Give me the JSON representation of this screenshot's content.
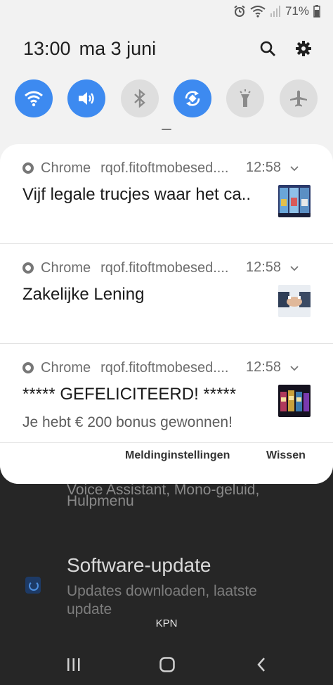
{
  "status_bar": {
    "battery": "71%",
    "icons": [
      "alarm-icon",
      "wifi-icon",
      "signal-icon",
      "battery-icon"
    ]
  },
  "header": {
    "time": "13:00",
    "date": "ma 3 juni",
    "icons": [
      "search-icon",
      "gear-icon"
    ]
  },
  "quick_toggles": [
    {
      "name": "wifi",
      "state": "on"
    },
    {
      "name": "sound",
      "state": "on"
    },
    {
      "name": "bluetooth",
      "state": "off"
    },
    {
      "name": "auto-rotate",
      "state": "on"
    },
    {
      "name": "flashlight",
      "state": "off"
    },
    {
      "name": "airplane-mode",
      "state": "off"
    }
  ],
  "notifications": [
    {
      "app": "Chrome",
      "site": "rqof.fitoftmobesed....",
      "time": "12:58",
      "title": "Vijf legale trucjes waar het ca..",
      "body": ""
    },
    {
      "app": "Chrome",
      "site": "rqof.fitoftmobesed....",
      "time": "12:58",
      "title": "Zakelijke Lening",
      "body": ""
    },
    {
      "app": "Chrome",
      "site": "rqof.fitoftmobesed....",
      "time": "12:58",
      "title": "***** GEFELICITEERD! *****",
      "body": "Je hebt € 200 bonus gewonnen!"
    }
  ],
  "actions": {
    "settings_label": "Meldinginstellingen",
    "clear_label": "Wissen"
  },
  "background": {
    "item1_title": "Voice Assistant, Mono-geluid,",
    "item1_sub": "Hulpmenu",
    "item2_title": "Software-update",
    "item2_sub": "Updates downloaden, laatste update"
  },
  "carrier": "KPN",
  "colors": {
    "accent": "#3d8af0",
    "shade_bg": "#f2f2f2",
    "panel_bg": "#ffffff"
  }
}
